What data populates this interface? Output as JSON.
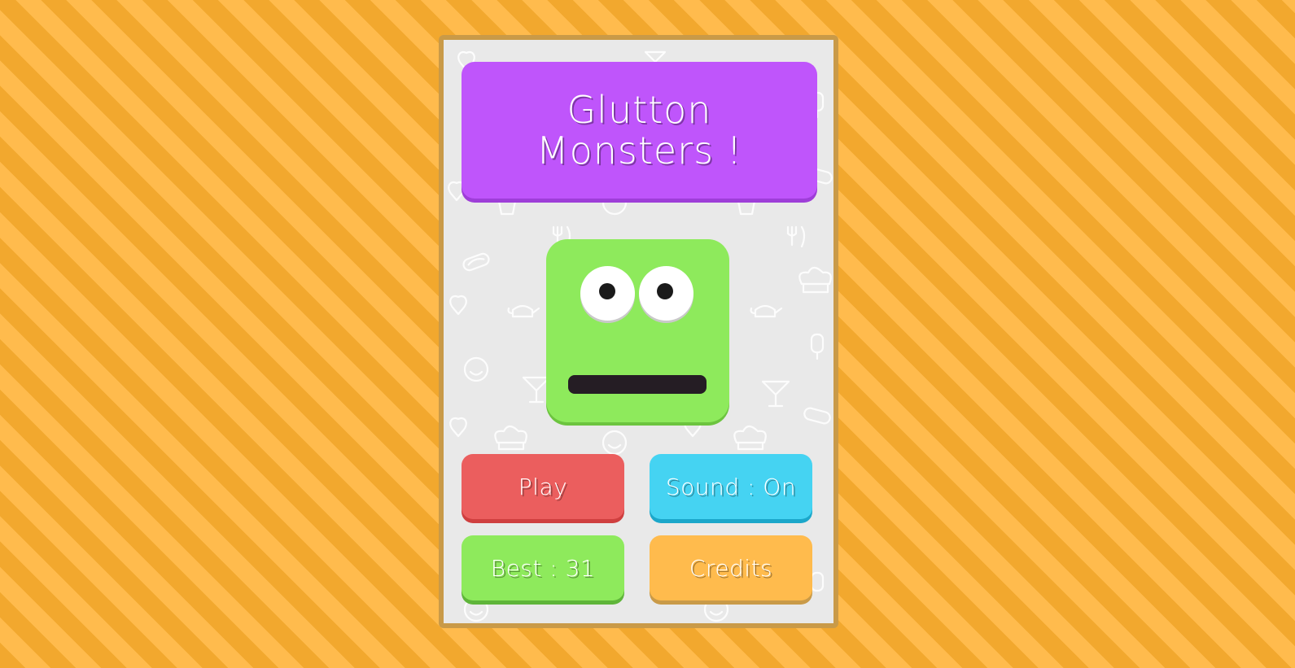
{
  "game": {
    "title": "Glutton\nMonsters !"
  },
  "menu": {
    "play_label": "Play",
    "sound_label": "Sound : On",
    "best_label": "Best : 31",
    "credits_label": "Credits"
  },
  "colors": {
    "background_stripe_dark": "#f2a82e",
    "background_stripe_light": "#ffbb4d",
    "panel_border": "#c99a48",
    "panel_bg": "#e9e9e9",
    "title_card": "#bf55fb",
    "monster_body": "#8eea5c",
    "play_button": "#eb5e5e",
    "sound_button": "#45d3f2",
    "best_button": "#8eea5c",
    "credits_button": "#ffbb4d"
  },
  "decorations": {
    "doodle_icons": [
      "heart-icon",
      "smiley-icon",
      "teapot-icon",
      "fork-knife-icon",
      "cocktail-icon",
      "popsicle-icon",
      "hotdog-icon",
      "chef-hat-icon",
      "burger-icon"
    ]
  }
}
